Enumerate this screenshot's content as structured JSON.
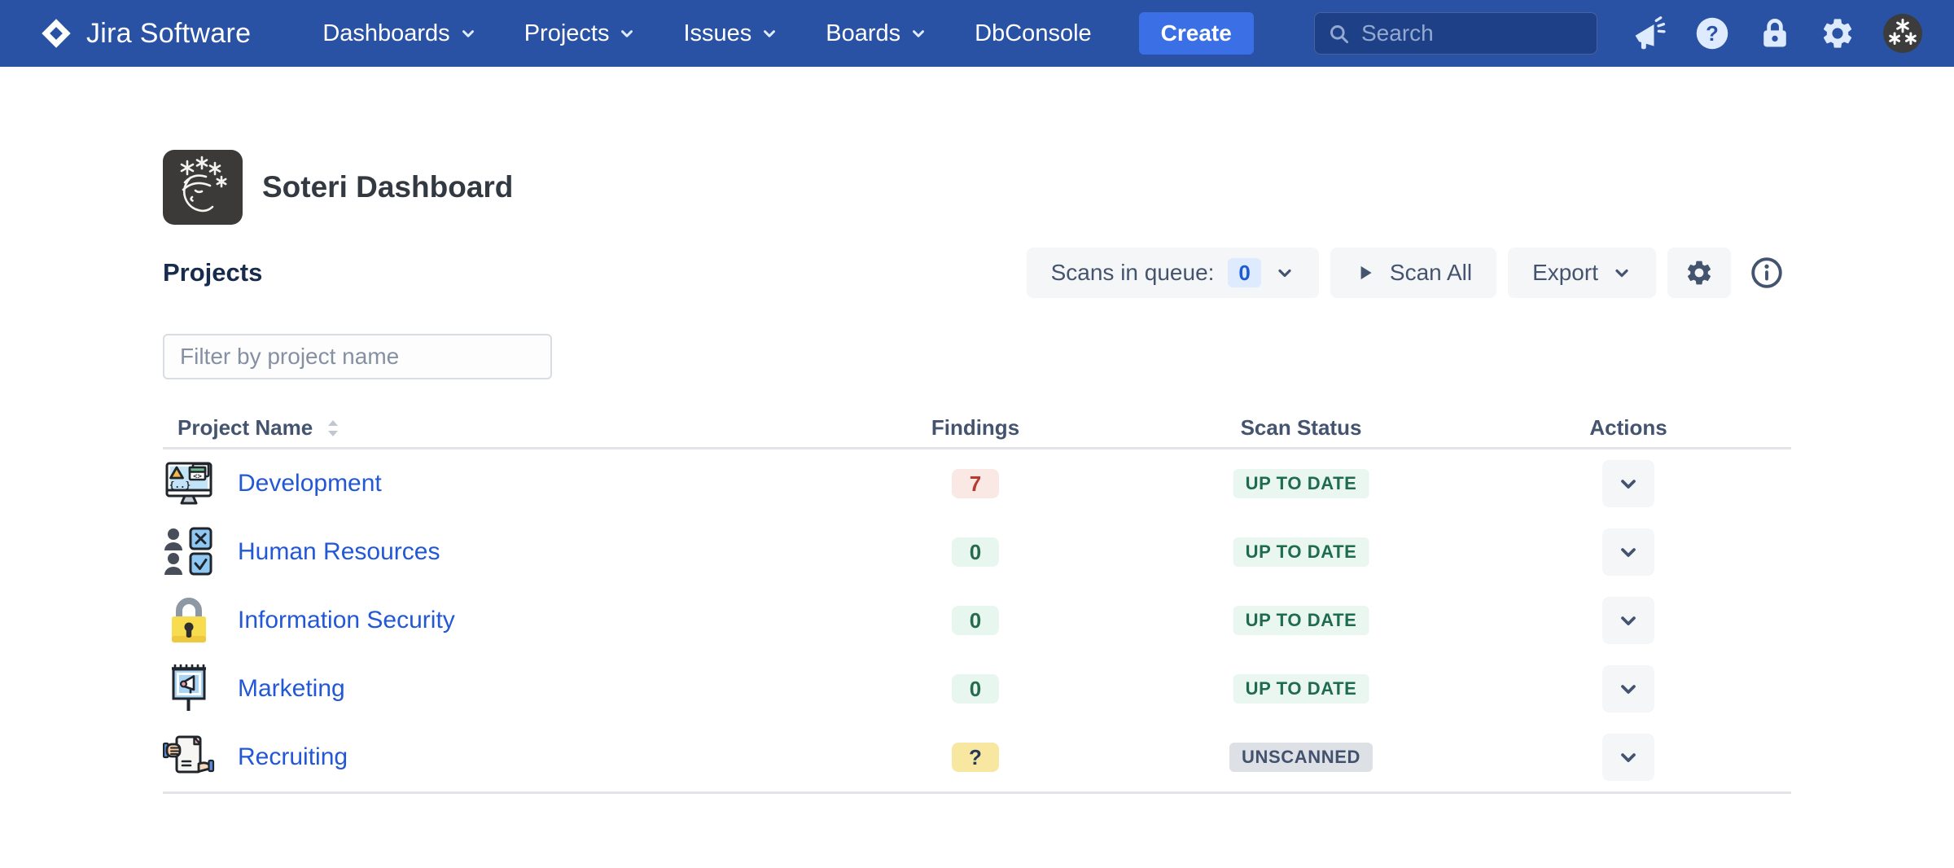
{
  "navbar": {
    "logo_text": "Jira Software",
    "items": [
      {
        "label": "Dashboards",
        "dropdown": true
      },
      {
        "label": "Projects",
        "dropdown": true
      },
      {
        "label": "Issues",
        "dropdown": true
      },
      {
        "label": "Boards",
        "dropdown": true
      },
      {
        "label": "DbConsole",
        "dropdown": false
      }
    ],
    "create_label": "Create",
    "search_placeholder": "Search",
    "icons": [
      "megaphone-icon",
      "help-icon",
      "lock-icon",
      "gear-icon",
      "avatar"
    ]
  },
  "header": {
    "app_icon": "soteri-logo",
    "title": "Soteri Dashboard"
  },
  "section": {
    "title": "Projects"
  },
  "toolbar": {
    "scans_in_queue_label": "Scans in queue:",
    "scans_in_queue_count": "0",
    "scan_all_label": "Scan All",
    "export_label": "Export",
    "icons": [
      "gear-icon",
      "info-icon"
    ]
  },
  "filter": {
    "placeholder": "Filter by project name"
  },
  "table": {
    "columns": [
      "Project Name",
      "Findings",
      "Scan Status",
      "Actions"
    ],
    "rows": [
      {
        "name": "Development",
        "icon": "development-icon",
        "findings": "7",
        "findings_variant": "red",
        "status": "UP TO DATE",
        "status_variant": "green"
      },
      {
        "name": "Human Resources",
        "icon": "human-resources-icon",
        "findings": "0",
        "findings_variant": "green",
        "status": "UP TO DATE",
        "status_variant": "green"
      },
      {
        "name": "Information Security",
        "icon": "information-security-icon",
        "findings": "0",
        "findings_variant": "green",
        "status": "UP TO DATE",
        "status_variant": "green"
      },
      {
        "name": "Marketing",
        "icon": "marketing-icon",
        "findings": "0",
        "findings_variant": "green",
        "status": "UP TO DATE",
        "status_variant": "green"
      },
      {
        "name": "Recruiting",
        "icon": "recruiting-icon",
        "findings": "?",
        "findings_variant": "yellow",
        "status": "UNSCANNED",
        "status_variant": "gray"
      }
    ]
  },
  "colors": {
    "navbar_bg": "#2A52A4",
    "create_button_bg": "#3B6FE5",
    "link_blue": "#2257D6",
    "queue_badge_bg": "#DEEBFF",
    "queue_badge_text": "#1D5BD6",
    "findings_red_bg": "#FAE8E4",
    "findings_red_text": "#B43B2E",
    "findings_green_bg": "#E7F6EE",
    "findings_green_text": "#276B4D",
    "findings_yellow_bg": "#F7E7A1",
    "findings_yellow_text": "#253858",
    "status_green_bg": "#E9F7F0",
    "status_green_text": "#1F6B4D",
    "status_gray_bg": "#DDE0E5",
    "status_gray_text": "#42526E"
  }
}
